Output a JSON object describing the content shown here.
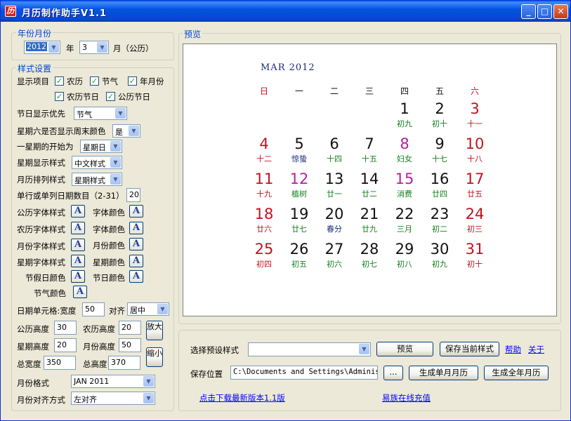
{
  "window": {
    "title": "月历制作助手V1.1"
  },
  "colors": {
    "red": "#c1121f",
    "black": "#111111",
    "green": "#12801e",
    "holiday": "#b2229b",
    "blue": "#1a2a7a"
  },
  "year_month": {
    "legend": "年份月份",
    "year": "2012",
    "year_label": "年",
    "month": "3",
    "month_label": "月（公历）"
  },
  "style": {
    "legend": "样式设置",
    "display_items_label": "显示项目",
    "checkboxes": {
      "gregorian": "农历",
      "solar_term": "节气",
      "year_month": "年月份",
      "lunar_holiday": "农历节日",
      "gregorian_holiday": "公历节日"
    },
    "holiday_priority_label": "节日显示优先",
    "holiday_priority_value": "节气",
    "saturday_weekend_label": "星期六是否显示周末颜色",
    "saturday_weekend_value": "是",
    "week_start_label": "一星期的开始为",
    "week_start_value": "星期日",
    "week_display_label": "星期显示样式",
    "week_display_value": "中文样式",
    "month_arrange_label": "月历排列样式",
    "month_arrange_value": "星期样式",
    "dates_per_row_label": "单行或单列日期数目（2-31）",
    "dates_per_row_value": "20",
    "gregorian_font_label": "公历字体样式",
    "font_color_label": "字体颜色",
    "lunar_font_label": "农历字体样式",
    "font_color_label2": "字体颜色",
    "month_font_label": "月份字体样式",
    "month_color_label": "月份颜色",
    "week_font_label": "星期字体样式",
    "week_color_label": "星期颜色",
    "holiday_color_label": "节假日颜色",
    "festival_color_label": "节日颜色",
    "solar_term_color_label": "节气颜色",
    "font_button_glyph": "A",
    "cell_label": "日期单元格:宽度",
    "cell_width": "50",
    "align_label": "对齐",
    "align_value": "居中",
    "gregorian_height_label": "公历高度",
    "gregorian_height": "30",
    "lunar_height_label": "农历高度",
    "lunar_height": "20",
    "week_height_label": "星期高度",
    "week_height": "20",
    "month_height_label": "月份高度",
    "month_height": "50",
    "total_width_label": "总宽度",
    "total_width": "350",
    "total_height_label": "总高度",
    "total_height": "370",
    "zoom_in_label": "放大",
    "zoom_out_label": "缩小",
    "month_format_label": "月份格式",
    "month_format_value": "JAN 2011",
    "month_align_label": "月份对齐方式",
    "month_align_value": "左对齐"
  },
  "preview": {
    "legend": "预览",
    "title": "MAR 2012",
    "weekdays": [
      "日",
      "一",
      "二",
      "三",
      "四",
      "五",
      "六"
    ],
    "rows": [
      [
        null,
        null,
        null,
        null,
        {
          "d": "1",
          "l": "初九",
          "c": "black",
          "lc": "green"
        },
        {
          "d": "2",
          "l": "初十",
          "c": "black",
          "lc": "green"
        },
        {
          "d": "3",
          "l": "十一",
          "c": "red",
          "lc": "red"
        }
      ],
      [
        {
          "d": "4",
          "l": "十二",
          "c": "red",
          "lc": "red"
        },
        {
          "d": "5",
          "l": "惊蛰",
          "c": "black",
          "lc": "blue"
        },
        {
          "d": "6",
          "l": "十四",
          "c": "black",
          "lc": "green"
        },
        {
          "d": "7",
          "l": "十五",
          "c": "black",
          "lc": "green"
        },
        {
          "d": "8",
          "l": "妇女",
          "c": "holiday",
          "lc": "green"
        },
        {
          "d": "9",
          "l": "十七",
          "c": "black",
          "lc": "green"
        },
        {
          "d": "10",
          "l": "十八",
          "c": "red",
          "lc": "red"
        }
      ],
      [
        {
          "d": "11",
          "l": "十九",
          "c": "red",
          "lc": "red"
        },
        {
          "d": "12",
          "l": "植树",
          "c": "holiday",
          "lc": "green"
        },
        {
          "d": "13",
          "l": "廿一",
          "c": "black",
          "lc": "green"
        },
        {
          "d": "14",
          "l": "廿二",
          "c": "black",
          "lc": "green"
        },
        {
          "d": "15",
          "l": "消费",
          "c": "holiday",
          "lc": "green"
        },
        {
          "d": "16",
          "l": "廿四",
          "c": "black",
          "lc": "green"
        },
        {
          "d": "17",
          "l": "廿五",
          "c": "red",
          "lc": "red"
        }
      ],
      [
        {
          "d": "18",
          "l": "廿六",
          "c": "red",
          "lc": "red"
        },
        {
          "d": "19",
          "l": "廿七",
          "c": "black",
          "lc": "green"
        },
        {
          "d": "20",
          "l": "春分",
          "c": "black",
          "lc": "blue"
        },
        {
          "d": "21",
          "l": "廿九",
          "c": "black",
          "lc": "green"
        },
        {
          "d": "22",
          "l": "三月",
          "c": "black",
          "lc": "green"
        },
        {
          "d": "23",
          "l": "初二",
          "c": "black",
          "lc": "green"
        },
        {
          "d": "24",
          "l": "初三",
          "c": "red",
          "lc": "red"
        }
      ],
      [
        {
          "d": "25",
          "l": "初四",
          "c": "red",
          "lc": "red"
        },
        {
          "d": "26",
          "l": "初五",
          "c": "black",
          "lc": "green"
        },
        {
          "d": "27",
          "l": "初六",
          "c": "black",
          "lc": "green"
        },
        {
          "d": "28",
          "l": "初七",
          "c": "black",
          "lc": "green"
        },
        {
          "d": "29",
          "l": "初八",
          "c": "black",
          "lc": "green"
        },
        {
          "d": "30",
          "l": "初九",
          "c": "black",
          "lc": "green"
        },
        {
          "d": "31",
          "l": "初十",
          "c": "red",
          "lc": "red"
        }
      ]
    ]
  },
  "bottom": {
    "preset_label": "选择预设样式",
    "preset_value": "",
    "preview_button": "预览",
    "save_style_button": "保存当前样式",
    "help_link": "帮助",
    "about_link": "关于",
    "save_location_label": "保存位置",
    "save_path": "C:\\Documents and Settings\\Administ",
    "browse_button": "...",
    "gen_month_button": "生成单月月历",
    "gen_year_button": "生成全年月历",
    "download_link": "点击下载最新版本1.1版",
    "recharge_link": "易族在线充值"
  }
}
